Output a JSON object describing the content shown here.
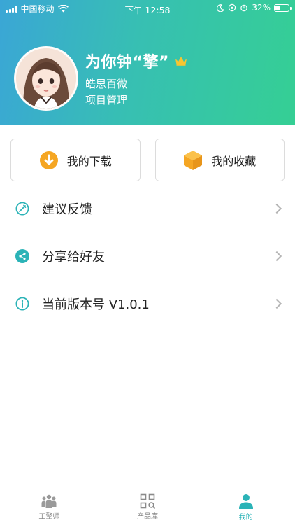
{
  "status_bar": {
    "carrier": "中国移动",
    "time": "下午 12:58",
    "battery": "32%",
    "battery_level": 0.32
  },
  "profile": {
    "name": "为你钟“擎”",
    "badge_icon": "crown-icon",
    "line1": "皓思百微",
    "line2": "项目管理"
  },
  "actions": [
    {
      "label": "我的下载",
      "icon": "download-icon",
      "color": "#f5a623"
    },
    {
      "label": "我的收藏",
      "icon": "box-icon",
      "color": "#f5a623"
    }
  ],
  "menu": [
    {
      "label": "建议反馈",
      "icon": "feedback-icon"
    },
    {
      "label": "分享给好友",
      "icon": "share-icon"
    },
    {
      "label": "当前版本号 V1.0.1",
      "icon": "info-icon"
    }
  ],
  "tabs": [
    {
      "label": "工擎师",
      "icon": "people-icon",
      "active": false
    },
    {
      "label": "产品库",
      "icon": "grid-search-icon",
      "active": false
    },
    {
      "label": "我的",
      "icon": "user-icon",
      "active": true
    }
  ],
  "colors": {
    "accent": "#2bb3b7",
    "header_start": "#3aa6d6",
    "header_end": "#35cf94",
    "action_icon": "#f5a623"
  }
}
